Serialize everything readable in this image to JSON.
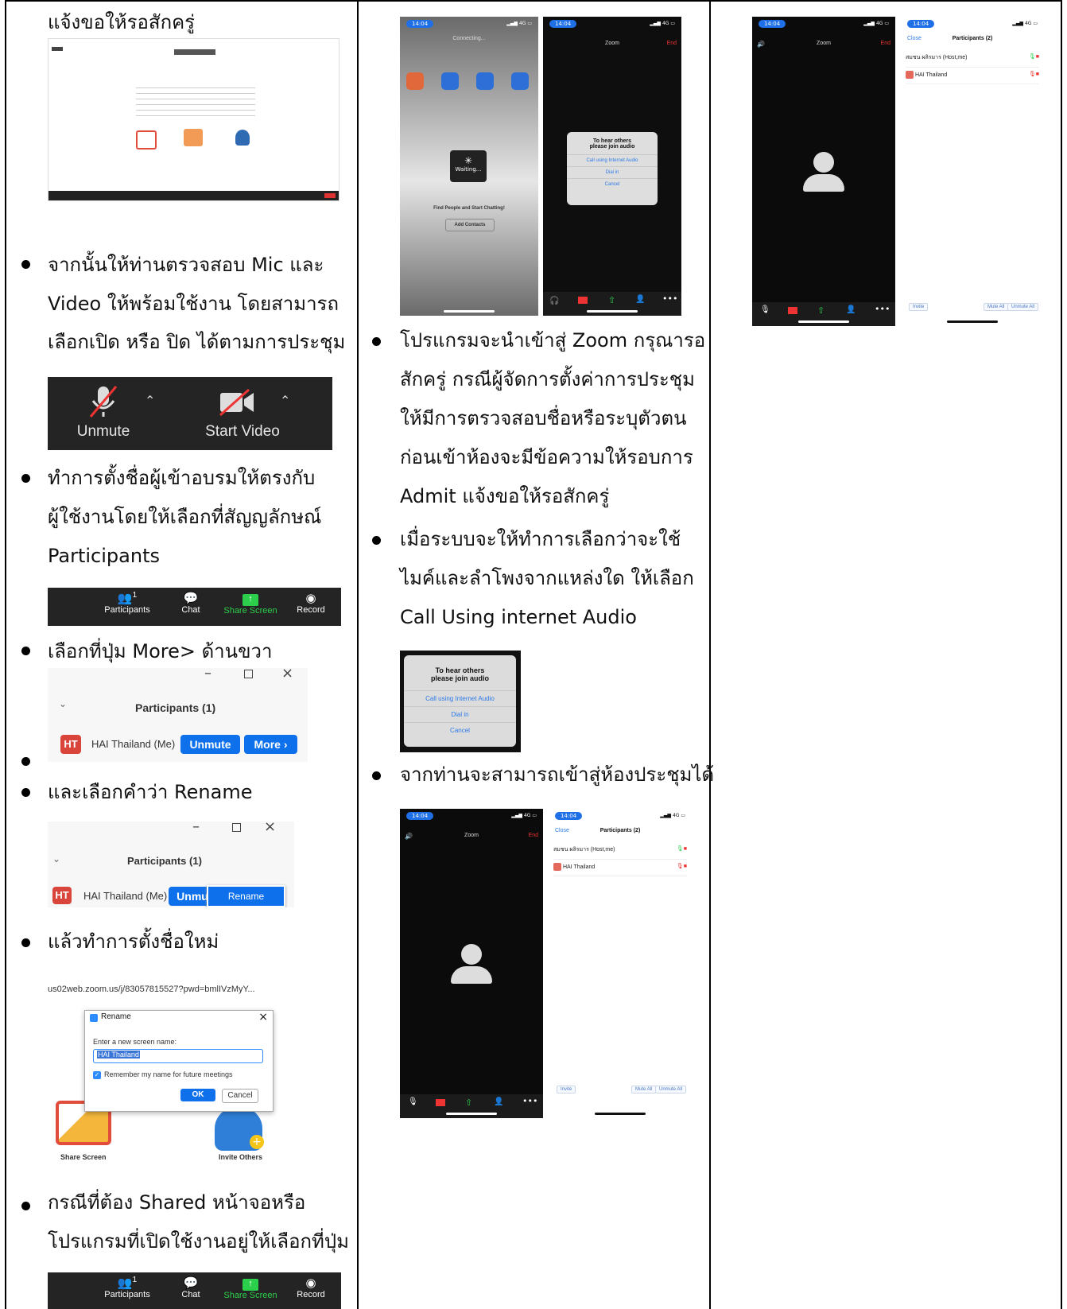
{
  "col1": {
    "top_text": "แจ้งขอให้รอสักครู่",
    "bullet1": [
      "จากนั้นให้ท่านตรวจสอบ Mic และ",
      "Video ให้พร้อมใช้งาน โดยสามารถ",
      "เลือกเปิด หรือ ปิด ได้ตามการประชุม"
    ],
    "unmute_label": "Unmute",
    "start_video_label": "Start Video",
    "bullet2": [
      "ทำการตั้งชื่อผู้เข้าอบรมให้ตรงกับ",
      "ผู้ใช้งานโดยให้เลือกที่สัญญลักษณ์",
      "Participants"
    ],
    "toolbar": {
      "participants": "Participants",
      "count": "1",
      "chat": "Chat",
      "share": "Share Screen",
      "record": "Record"
    },
    "bullet3": "เลือกที่ปุ่ม More> ด้านขวา",
    "panel1": {
      "title": "Participants (1)",
      "initials": "HT",
      "name": "HAI Thailand (Me)",
      "unmute": "Unmute",
      "more": "More ›"
    },
    "bullet5": "และเลือกคำว่า Rename",
    "panel2": {
      "title": "Participants (1)",
      "initials": "HT",
      "name": "HAI Thailand (Me)",
      "unmute": "Unmu",
      "rename": "Rename"
    },
    "bullet6": "แล้วทำการตั้งชื่อใหม่",
    "rename_dialog": {
      "url": "us02web.zoom.us/j/83057815527?pwd=bmlIVzMyY...",
      "title": "Rename",
      "prompt": "Enter a new screen name:",
      "value": "HAI Thailand",
      "remember": "Remember my name for future meetings",
      "ok": "OK",
      "cancel": "Cancel",
      "share_label": "Share Screen",
      "invite_label": "Invite Others"
    },
    "bullet7": [
      "กรณีที่ต้อง Shared หน้าจอหรือ",
      "โปรแกรมที่เปิดใช้งานอยู่ให้เลือกที่ปุ่ม"
    ]
  },
  "col2": {
    "phoneA": {
      "time": "14:04",
      "connecting": "Connecting...",
      "waiting": "Waiting...",
      "find": "Find People and Start Chatting!",
      "add": "Add Contacts"
    },
    "phoneB": {
      "time": "14:04",
      "title": "Zoom",
      "end": "End",
      "dlg_title1": "To hear others",
      "dlg_title2": "please join audio",
      "opt1": "Call using Internet Audio",
      "opt2": "Dial in",
      "opt3": "Cancel"
    },
    "bullet1": [
      "โปรแกรมจะนำเข้าสู่ Zoom กรุณารอ",
      "สักครู่ กรณีผู้จัดการตั้งค่าการประชุม",
      "ให้มีการตรวจสอบชื่อหรือระบุตัวตน",
      "ก่อนเข้าห้องจะมีข้อความให้รอบการ",
      "Admit แจ้งขอให้รอสักครู่"
    ],
    "bullet2": [
      "เมื่อระบบจะให้ทำการเลือกว่าจะใช้",
      "ไมค์และลำโพงจากแหล่งใด ให้เลือก",
      "Call Using internet Audio"
    ],
    "audio_dlg": {
      "t1": "To hear others",
      "t2": "please join audio",
      "o1": "Call using Internet Audio",
      "o2": "Dial in",
      "o3": "Cancel"
    },
    "bullet3": "จากท่านจะสามารถเข้าสู่ห้องประชุมได้",
    "meet": {
      "time": "14:04",
      "title": "Zoom",
      "end": "End",
      "close": "Close",
      "ptitle": "Participants (2)",
      "host": "สมชน ผลิรมาร (Host,me)",
      "p2": "HAI Thailand",
      "invite": "Invite",
      "mute_all": "Mute All",
      "unmute_all": "Unmute All"
    }
  },
  "col3": {
    "meet": {
      "time": "14:04",
      "title": "Zoom",
      "end": "End",
      "close": "Close",
      "ptitle": "Participants (2)",
      "host": "สมชน ผลิรมาร (Host,me)",
      "p2": "HAI Thailand",
      "invite": "Invite",
      "mute_all": "Mute All",
      "unmute_all": "Unmute All"
    }
  }
}
